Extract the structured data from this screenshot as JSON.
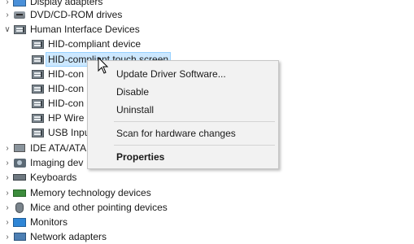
{
  "tree": [
    {
      "label": "Display adapters",
      "icon": "display-adapter-icon",
      "chevron": "collapsed",
      "indent": 0
    },
    {
      "label": "DVD/CD-ROM drives",
      "icon": "disc-drive-icon",
      "chevron": "collapsed",
      "indent": 0
    },
    {
      "label": "Human Interface Devices",
      "icon": "hid-icon",
      "chevron": "expanded",
      "indent": 0
    },
    {
      "label": "HID-compliant device",
      "icon": "hid-icon",
      "chevron": "none",
      "indent": 1
    },
    {
      "label": "HID-compliant touch screen",
      "icon": "hid-icon",
      "chevron": "none",
      "indent": 1,
      "selected": true
    },
    {
      "label": "HID-con",
      "icon": "hid-icon",
      "chevron": "none",
      "indent": 1
    },
    {
      "label": "HID-con",
      "icon": "hid-icon",
      "chevron": "none",
      "indent": 1
    },
    {
      "label": "HID-con",
      "icon": "hid-icon",
      "chevron": "none",
      "indent": 1
    },
    {
      "label": "HP Wire",
      "icon": "hid-icon",
      "chevron": "none",
      "indent": 1
    },
    {
      "label": "USB Inpu",
      "icon": "hid-icon",
      "chevron": "none",
      "indent": 1
    },
    {
      "label": "IDE ATA/ATA",
      "icon": "ide-controller-icon",
      "chevron": "collapsed",
      "indent": 0
    },
    {
      "label": "Imaging dev",
      "icon": "imaging-device-icon",
      "chevron": "collapsed",
      "indent": 0
    },
    {
      "label": "Keyboards",
      "icon": "keyboard-icon",
      "chevron": "collapsed",
      "indent": 0
    },
    {
      "label": "Memory technology devices",
      "icon": "memory-icon",
      "chevron": "collapsed",
      "indent": 0
    },
    {
      "label": "Mice and other pointing devices",
      "icon": "mouse-icon",
      "chevron": "collapsed",
      "indent": 0
    },
    {
      "label": "Monitors",
      "icon": "monitor-icon",
      "chevron": "collapsed",
      "indent": 0
    },
    {
      "label": "Network adapters",
      "icon": "network-adapter-icon",
      "chevron": "collapsed",
      "indent": 0
    }
  ],
  "context_menu": {
    "update_driver": "Update Driver Software...",
    "disable": "Disable",
    "uninstall": "Uninstall",
    "scan": "Scan for hardware changes",
    "properties": "Properties"
  }
}
